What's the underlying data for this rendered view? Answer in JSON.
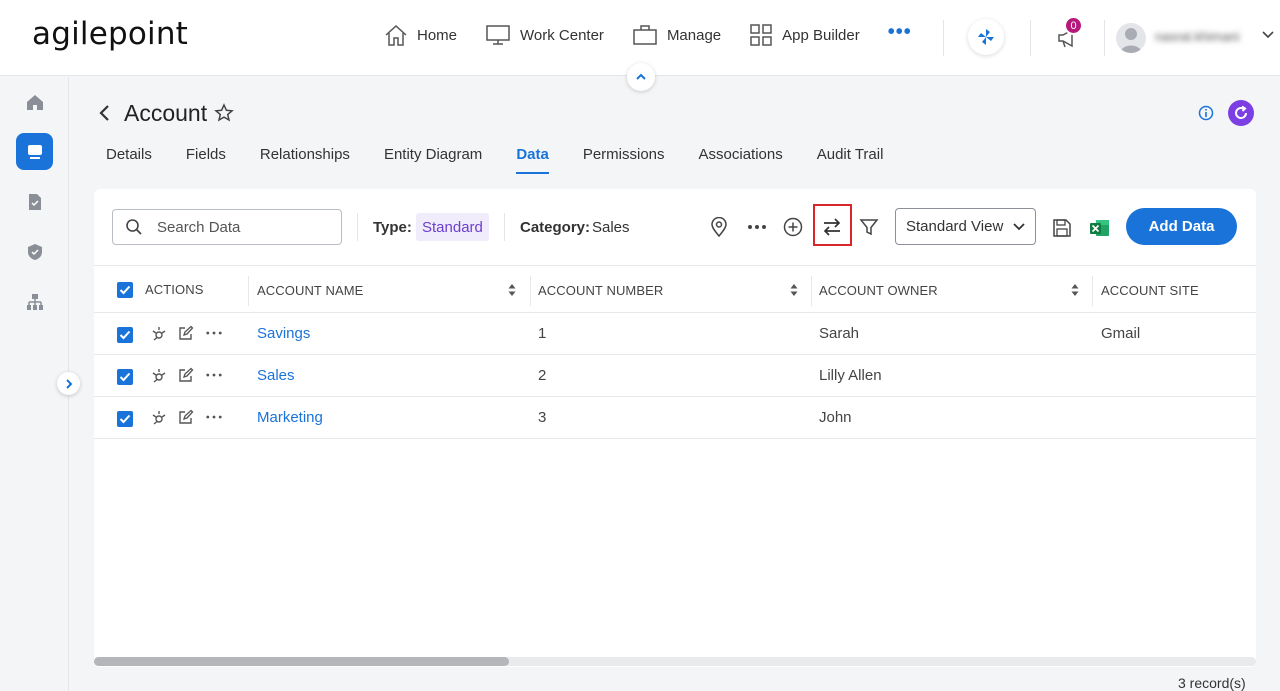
{
  "brand": {
    "logo_text": "agilepoint"
  },
  "nav": {
    "items": [
      {
        "label": "Home",
        "icon": "home-icon"
      },
      {
        "label": "Work Center",
        "icon": "monitor-icon"
      },
      {
        "label": "Manage",
        "icon": "briefcase-icon"
      },
      {
        "label": "App Builder",
        "icon": "grid-icon"
      }
    ],
    "more": "•••"
  },
  "notifications": {
    "count": "0"
  },
  "user": {
    "name": "nasrat.khimani"
  },
  "page": {
    "title": "Account"
  },
  "tabs": [
    {
      "label": "Details"
    },
    {
      "label": "Fields"
    },
    {
      "label": "Relationships"
    },
    {
      "label": "Entity Diagram"
    },
    {
      "label": "Data",
      "active": true
    },
    {
      "label": "Permissions"
    },
    {
      "label": "Associations"
    },
    {
      "label": "Audit Trail"
    }
  ],
  "toolbar": {
    "search_placeholder": "Search Data",
    "type_label": "Type:",
    "type_value": "Standard",
    "category_label": "Category:",
    "category_value": "Sales",
    "view_select": "Standard View",
    "add_button": "Add Data"
  },
  "table": {
    "columns": [
      "ACTIONS",
      "ACCOUNT NAME",
      "ACCOUNT NUMBER",
      "ACCOUNT OWNER",
      "ACCOUNT SITE"
    ],
    "rows": [
      {
        "name": "Savings",
        "number": "1",
        "owner": "Sarah",
        "site": "Gmail"
      },
      {
        "name": "Sales",
        "number": "2",
        "owner": "Lilly Allen",
        "site": ""
      },
      {
        "name": "Marketing",
        "number": "3",
        "owner": "John",
        "site": ""
      }
    ]
  },
  "footer": {
    "records": "3 record(s)"
  },
  "colors": {
    "accent": "#1a73d9",
    "chip_bg": "#f1ecfb",
    "chip_text": "#6b3fd0",
    "badge": "#b5197b",
    "highlight": "#d9262c"
  }
}
